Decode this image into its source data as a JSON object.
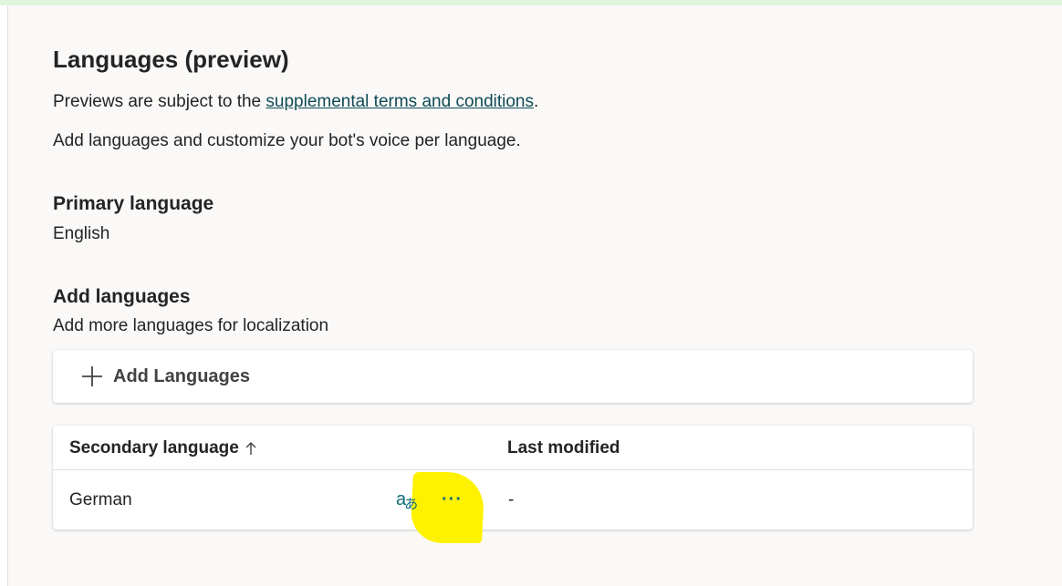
{
  "page": {
    "title": "Languages (preview)",
    "preview_prefix": "Previews are subject to the ",
    "preview_link": "supplemental terms and conditions",
    "preview_suffix": ".",
    "description": "Add languages and customize your bot's voice per language."
  },
  "primary_language": {
    "heading": "Primary language",
    "value": "English"
  },
  "add_languages": {
    "heading": "Add languages",
    "description": "Add more languages for localization",
    "button_label": "Add Languages",
    "button_icon": "plus-icon"
  },
  "table": {
    "columns": [
      {
        "label": "Secondary language",
        "sort_icon": "arrow-up-icon"
      },
      {
        "label": "Last modified"
      }
    ],
    "rows": [
      {
        "language": "German",
        "translate_icon_glyph_main": "a",
        "translate_icon_glyph_sub": "あ",
        "more_icon_glyph": "···",
        "last_modified": "-"
      }
    ]
  },
  "colors": {
    "accent": "#0f6b78",
    "link": "#0f4b55",
    "top_strip": "#dff6dd",
    "highlight": "#fff200",
    "panel_bg": "#faf9f8"
  }
}
